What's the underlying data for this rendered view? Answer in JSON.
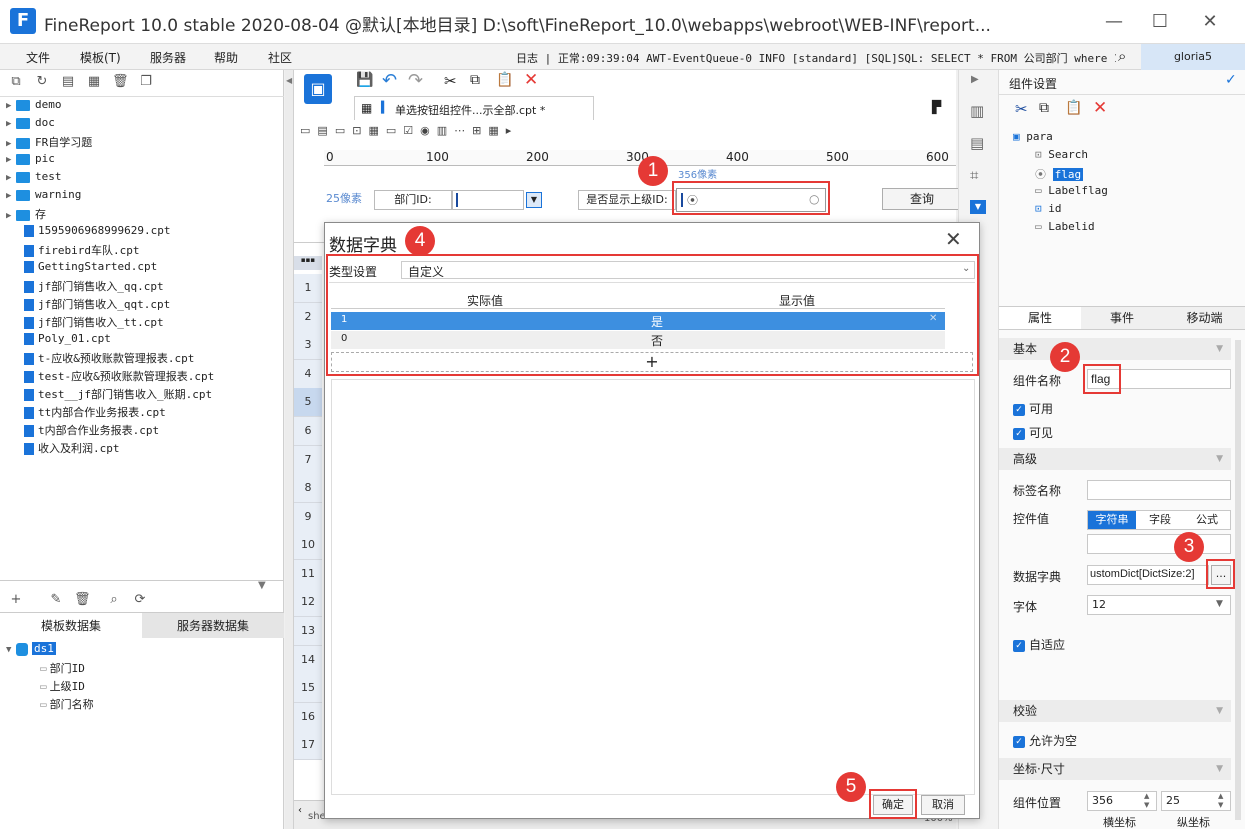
{
  "window": {
    "title": "FineReport 10.0 stable 2020-08-04 @默认[本地目录]    D:\\soft\\FineReport_10.0\\webapps\\webroot\\WEB-INF\\report...",
    "logo": "F",
    "minimize": "—",
    "maximize": "☐",
    "close": "✕"
  },
  "menubar": {
    "items": [
      "文件",
      "模板(T)",
      "服务器",
      "帮助",
      "社区"
    ],
    "log": "日志 | 正常:09:39:04 AWT-EventQueue-0 INFO [standard] [SQL]SQL: SELECT * FROM 公司部门 where 1=2",
    "user": "gloria5"
  },
  "tree": {
    "folders": [
      "demo",
      "doc",
      "FR自学习题",
      "pic",
      "test",
      "warning",
      "存"
    ],
    "files": [
      "1595906968999629.cpt",
      "firebird车队.cpt",
      "GettingStarted.cpt",
      "jf部门销售收入_qq.cpt",
      "jf部门销售收入_qqt.cpt",
      "jf部门销售收入_tt.cpt",
      "Poly_01.cpt",
      "t-应收&预收账款管理报表.cpt",
      "test-应收&预收账款管理报表.cpt",
      "test__jf部门销售收入_账期.cpt",
      "tt内部合作业务报表.cpt",
      "t内部合作业务报表.cpt",
      "收入及利润.cpt"
    ]
  },
  "dataset": {
    "tabs": [
      "模板数据集",
      "服务器数据集"
    ],
    "name": "ds1",
    "fields": [
      "部门ID",
      "上级ID",
      "部门名称"
    ]
  },
  "editor": {
    "tab_label": "单选按钮组控件...示全部.cpt *",
    "ruler": [
      "0",
      "100",
      "200",
      "300",
      "400",
      "500",
      "600"
    ],
    "pixel_label": "25像素",
    "pixel_label2": "356像素",
    "param_label1": "部门ID:",
    "param_label2": "是否显示上级ID:",
    "query_button": "查询",
    "rows": [
      "1",
      "2",
      "3",
      "4",
      "5",
      "6",
      "7",
      "8",
      "9",
      "10",
      "11",
      "12",
      "13",
      "14",
      "15",
      "16",
      "17"
    ],
    "sheet": "sheet1",
    "zoom": "100%"
  },
  "dialog": {
    "title": "数据字典",
    "type_label": "类型设置",
    "type_value": "自定义",
    "col_actual": "实际值",
    "col_display": "显示值",
    "rows": [
      {
        "actual": "1",
        "display": "是"
      },
      {
        "actual": "0",
        "display": "否"
      }
    ],
    "add": "+",
    "ok": "确定",
    "cancel": "取消"
  },
  "components": {
    "header": "组件设置",
    "tree": [
      "para",
      "Search",
      "flag",
      "Labelflag",
      "id",
      "Labelid"
    ]
  },
  "properties": {
    "tabs": [
      "属性",
      "事件",
      "移动端"
    ],
    "basic": "基本",
    "name_label": "组件名称",
    "name_value": "flag",
    "enabled": "可用",
    "visible": "可见",
    "advanced": "高级",
    "tag_label": "标签名称",
    "value_label": "控件值",
    "value_tabs": [
      "字符串",
      "字段",
      "公式"
    ],
    "dict_label": "数据字典",
    "dict_value": "ustomDict[DictSize:2]",
    "dict_btn": "...",
    "font_label": "字体",
    "font_value": "12",
    "autofit": "自适应",
    "validate": "校验",
    "allow_empty": "允许为空",
    "coords": "坐标·尺寸",
    "pos_label": "组件位置",
    "pos_x": "356",
    "pos_y": "25",
    "x_label": "横坐标",
    "y_label": "纵坐标"
  },
  "badges": [
    "1",
    "2",
    "3",
    "4",
    "5"
  ]
}
